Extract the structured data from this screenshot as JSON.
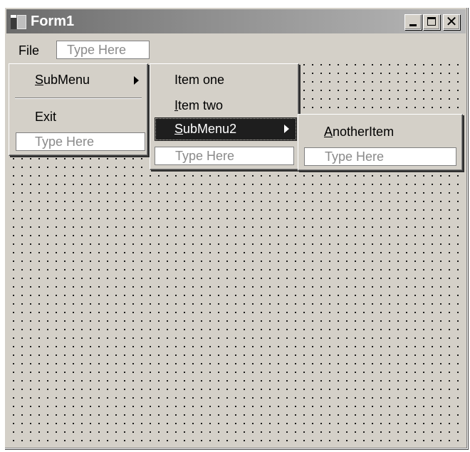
{
  "window": {
    "title": "Form1",
    "controls": {
      "minimize_icon": "minimize-icon",
      "maximize_icon": "maximize-icon",
      "close_glyph": "✕"
    }
  },
  "menubar": {
    "file_label": "File",
    "type_here": "Type Here"
  },
  "menus": {
    "file_menu": {
      "submenu_label_u": "S",
      "submenu_label_rest": "ubMenu",
      "exit_label": "Exit",
      "type_here": "Type Here"
    },
    "submenu": {
      "item_one": "Item one",
      "item_two_u": "I",
      "item_two_rest": "tem two",
      "submenu2_u": "S",
      "submenu2_rest": "ubMenu2",
      "type_here": "Type Here"
    },
    "submenu2": {
      "another_u": "A",
      "another_rest": "notherItem",
      "type_here": "Type Here"
    }
  },
  "colors": {
    "face": "#d4d0c8",
    "selection": "#1e1e1e",
    "placeholder_text": "#8a8a8a"
  }
}
